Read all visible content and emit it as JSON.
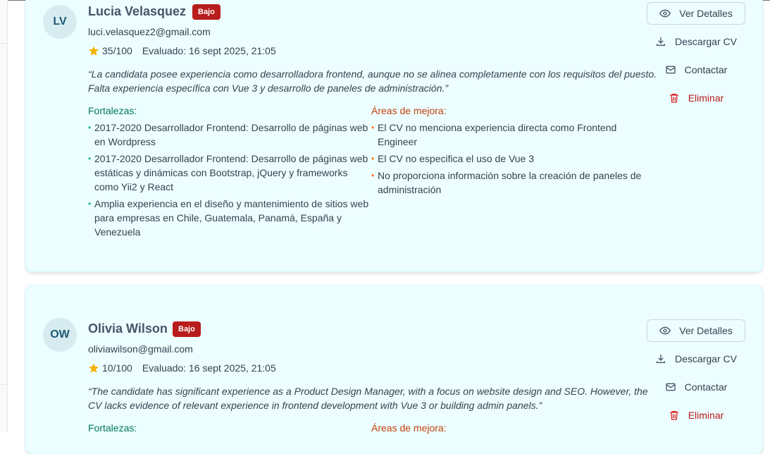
{
  "candidates": [
    {
      "initials": "LV",
      "name": "Lucia Velasquez",
      "level_badge": "Bajo",
      "email": "luci.velasquez2@gmail.com",
      "score": "35/100",
      "evaluated": "Evaluado: 16 sept 2025, 21:05",
      "summary": "“La candidata posee experiencia como desarrolladora frontend, aunque no se alinea completamente con los requisitos del puesto. Falta experiencia específica con Vue 3 y desarrollo de paneles de administración.”",
      "strengths_title": "Fortalezas:",
      "strengths": [
        "2017-2020 Desarrollador Frontend: Desarrollo de páginas web en Wordpress",
        "2017-2020 Desarrollador Frontend: Desarrollo de páginas web estáticas y dinámicas con Bootstrap, jQuery y frameworks como Yii2 y React",
        "Amplia experiencia en el diseño y mantenimiento de sitios web para empresas en Chile, Guatemala, Panamá, España y Venezuela"
      ],
      "improvements_title": "Áreas de mejora:",
      "improvements": [
        "El CV no menciona experiencia directa como Frontend Engineer",
        "El CV no especifica el uso de Vue 3",
        "No proporciona información sobre la creación de paneles de administración"
      ]
    },
    {
      "initials": "OW",
      "name": "Olivia Wilson",
      "level_badge": "Bajo",
      "email": "oliviawilson@gmail.com",
      "score": "10/100",
      "evaluated": "Evaluado: 16 sept 2025, 21:05",
      "summary": "“The candidate has significant experience as a Product Design Manager, with a focus on website design and SEO. However, the CV lacks evidence of relevant experience in frontend development with Vue 3 or building admin panels.”",
      "strengths_title": "Fortalezas:",
      "improvements_title": "Áreas de mejora:"
    }
  ],
  "actions": {
    "view_details": "Ver Detalles",
    "download_cv": "Descargar CV",
    "contact": "Contactar",
    "delete": "Eliminar"
  },
  "icons": {
    "view": "eye-icon",
    "download": "download-icon",
    "contact": "mail-icon",
    "delete": "trash-icon",
    "score": "star-icon"
  },
  "colors": {
    "card_bg": "#ecfeff",
    "badge_bg": "#b91c1c",
    "strength": "#047857",
    "improvement": "#c2410c",
    "star": "#f5b301"
  }
}
